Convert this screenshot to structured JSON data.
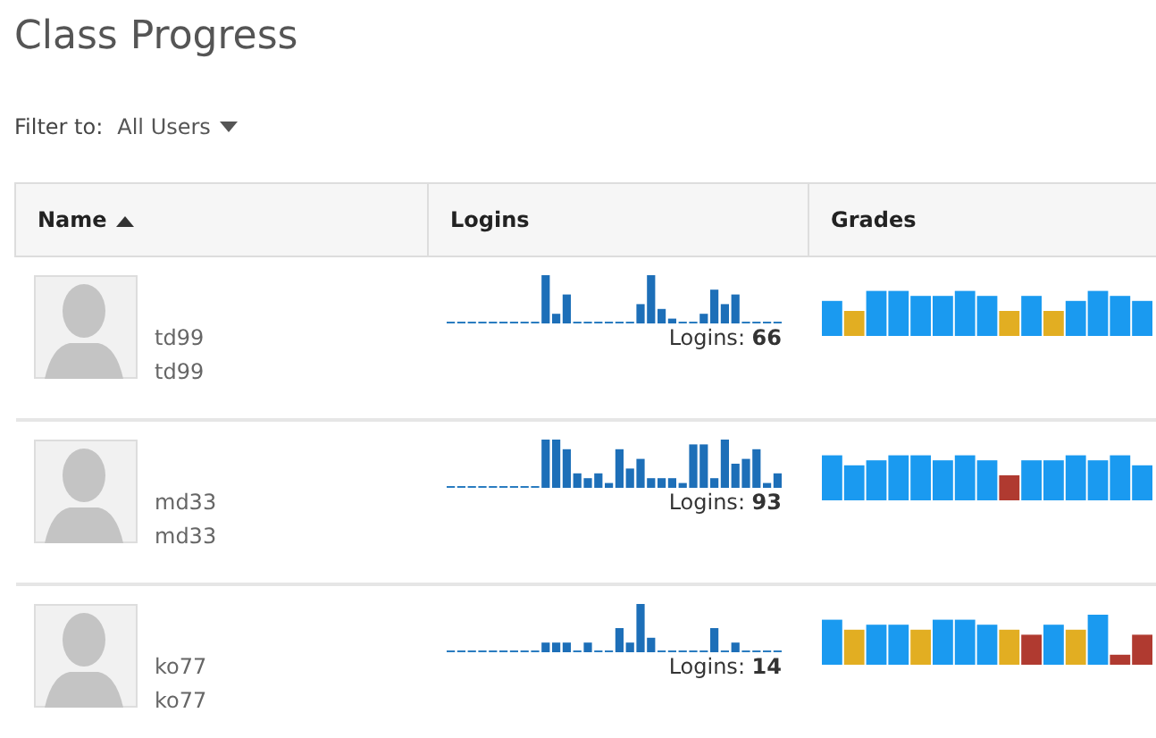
{
  "title": "Class Progress",
  "filter": {
    "label": "Filter to:",
    "value": "All Users"
  },
  "table": {
    "columns": [
      {
        "label": "Name",
        "sorted_ascending": true
      },
      {
        "label": "Logins"
      },
      {
        "label": "Grades"
      }
    ],
    "rows": [
      {
        "name": "td99",
        "username": "td99",
        "logins_label": "Logins:",
        "logins": "66"
      },
      {
        "name": "md33",
        "username": "md33",
        "logins_label": "Logins:",
        "logins": "93"
      },
      {
        "name": "ko77",
        "username": "ko77",
        "logins_label": "Logins:",
        "logins": "14"
      }
    ]
  }
}
